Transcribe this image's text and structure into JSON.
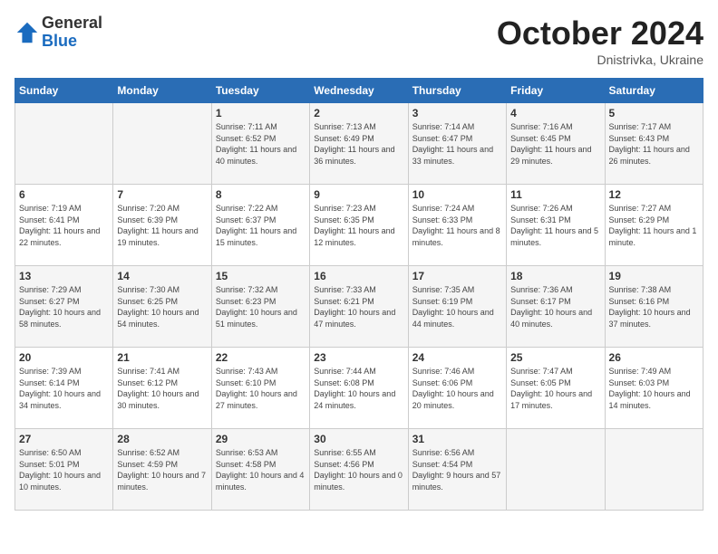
{
  "header": {
    "logo_general": "General",
    "logo_blue": "Blue",
    "month_title": "October 2024",
    "subtitle": "Dnistrivka, Ukraine"
  },
  "days_of_week": [
    "Sunday",
    "Monday",
    "Tuesday",
    "Wednesday",
    "Thursday",
    "Friday",
    "Saturday"
  ],
  "weeks": [
    [
      {
        "day": "",
        "info": ""
      },
      {
        "day": "",
        "info": ""
      },
      {
        "day": "1",
        "info": "Sunrise: 7:11 AM\nSunset: 6:52 PM\nDaylight: 11 hours and 40 minutes."
      },
      {
        "day": "2",
        "info": "Sunrise: 7:13 AM\nSunset: 6:49 PM\nDaylight: 11 hours and 36 minutes."
      },
      {
        "day": "3",
        "info": "Sunrise: 7:14 AM\nSunset: 6:47 PM\nDaylight: 11 hours and 33 minutes."
      },
      {
        "day": "4",
        "info": "Sunrise: 7:16 AM\nSunset: 6:45 PM\nDaylight: 11 hours and 29 minutes."
      },
      {
        "day": "5",
        "info": "Sunrise: 7:17 AM\nSunset: 6:43 PM\nDaylight: 11 hours and 26 minutes."
      }
    ],
    [
      {
        "day": "6",
        "info": "Sunrise: 7:19 AM\nSunset: 6:41 PM\nDaylight: 11 hours and 22 minutes."
      },
      {
        "day": "7",
        "info": "Sunrise: 7:20 AM\nSunset: 6:39 PM\nDaylight: 11 hours and 19 minutes."
      },
      {
        "day": "8",
        "info": "Sunrise: 7:22 AM\nSunset: 6:37 PM\nDaylight: 11 hours and 15 minutes."
      },
      {
        "day": "9",
        "info": "Sunrise: 7:23 AM\nSunset: 6:35 PM\nDaylight: 11 hours and 12 minutes."
      },
      {
        "day": "10",
        "info": "Sunrise: 7:24 AM\nSunset: 6:33 PM\nDaylight: 11 hours and 8 minutes."
      },
      {
        "day": "11",
        "info": "Sunrise: 7:26 AM\nSunset: 6:31 PM\nDaylight: 11 hours and 5 minutes."
      },
      {
        "day": "12",
        "info": "Sunrise: 7:27 AM\nSunset: 6:29 PM\nDaylight: 11 hours and 1 minute."
      }
    ],
    [
      {
        "day": "13",
        "info": "Sunrise: 7:29 AM\nSunset: 6:27 PM\nDaylight: 10 hours and 58 minutes."
      },
      {
        "day": "14",
        "info": "Sunrise: 7:30 AM\nSunset: 6:25 PM\nDaylight: 10 hours and 54 minutes."
      },
      {
        "day": "15",
        "info": "Sunrise: 7:32 AM\nSunset: 6:23 PM\nDaylight: 10 hours and 51 minutes."
      },
      {
        "day": "16",
        "info": "Sunrise: 7:33 AM\nSunset: 6:21 PM\nDaylight: 10 hours and 47 minutes."
      },
      {
        "day": "17",
        "info": "Sunrise: 7:35 AM\nSunset: 6:19 PM\nDaylight: 10 hours and 44 minutes."
      },
      {
        "day": "18",
        "info": "Sunrise: 7:36 AM\nSunset: 6:17 PM\nDaylight: 10 hours and 40 minutes."
      },
      {
        "day": "19",
        "info": "Sunrise: 7:38 AM\nSunset: 6:16 PM\nDaylight: 10 hours and 37 minutes."
      }
    ],
    [
      {
        "day": "20",
        "info": "Sunrise: 7:39 AM\nSunset: 6:14 PM\nDaylight: 10 hours and 34 minutes."
      },
      {
        "day": "21",
        "info": "Sunrise: 7:41 AM\nSunset: 6:12 PM\nDaylight: 10 hours and 30 minutes."
      },
      {
        "day": "22",
        "info": "Sunrise: 7:43 AM\nSunset: 6:10 PM\nDaylight: 10 hours and 27 minutes."
      },
      {
        "day": "23",
        "info": "Sunrise: 7:44 AM\nSunset: 6:08 PM\nDaylight: 10 hours and 24 minutes."
      },
      {
        "day": "24",
        "info": "Sunrise: 7:46 AM\nSunset: 6:06 PM\nDaylight: 10 hours and 20 minutes."
      },
      {
        "day": "25",
        "info": "Sunrise: 7:47 AM\nSunset: 6:05 PM\nDaylight: 10 hours and 17 minutes."
      },
      {
        "day": "26",
        "info": "Sunrise: 7:49 AM\nSunset: 6:03 PM\nDaylight: 10 hours and 14 minutes."
      }
    ],
    [
      {
        "day": "27",
        "info": "Sunrise: 6:50 AM\nSunset: 5:01 PM\nDaylight: 10 hours and 10 minutes."
      },
      {
        "day": "28",
        "info": "Sunrise: 6:52 AM\nSunset: 4:59 PM\nDaylight: 10 hours and 7 minutes."
      },
      {
        "day": "29",
        "info": "Sunrise: 6:53 AM\nSunset: 4:58 PM\nDaylight: 10 hours and 4 minutes."
      },
      {
        "day": "30",
        "info": "Sunrise: 6:55 AM\nSunset: 4:56 PM\nDaylight: 10 hours and 0 minutes."
      },
      {
        "day": "31",
        "info": "Sunrise: 6:56 AM\nSunset: 4:54 PM\nDaylight: 9 hours and 57 minutes."
      },
      {
        "day": "",
        "info": ""
      },
      {
        "day": "",
        "info": ""
      }
    ]
  ]
}
